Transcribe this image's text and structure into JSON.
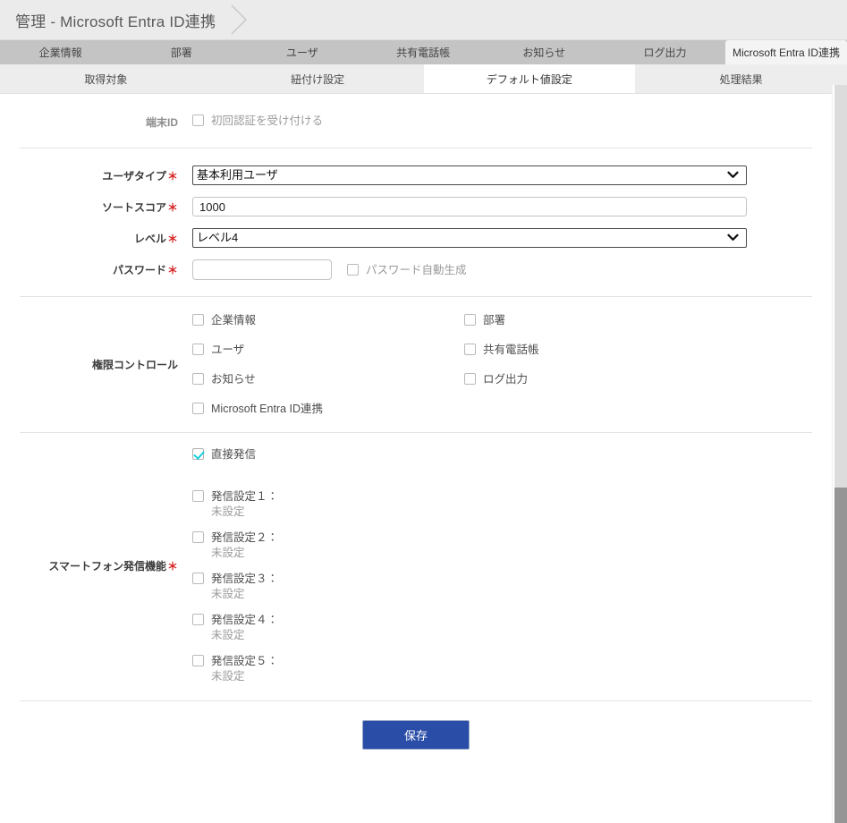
{
  "breadcrumb": {
    "title": "管理 - Microsoft Entra ID連携",
    "chevron_icon": "chevron-right-icon"
  },
  "primary_tabs": [
    {
      "label": "企業情報",
      "active": false
    },
    {
      "label": "部署",
      "active": false
    },
    {
      "label": "ユーザ",
      "active": false
    },
    {
      "label": "共有電話帳",
      "active": false
    },
    {
      "label": "お知らせ",
      "active": false
    },
    {
      "label": "ログ出力",
      "active": false
    },
    {
      "label": "Microsoft Entra ID連携",
      "active": true
    }
  ],
  "secondary_tabs": [
    {
      "label": "取得対象",
      "active": false
    },
    {
      "label": "紐付け設定",
      "active": false
    },
    {
      "label": "デフォルト値設定",
      "active": true
    },
    {
      "label": "処理結果",
      "active": false
    }
  ],
  "form": {
    "terminal": {
      "label": "端末ID",
      "checkbox_label": "初回認証を受け付ける",
      "checked": false,
      "disabled": true
    },
    "user_type": {
      "label": "ユーザタイプ",
      "required_mark": "＊",
      "value": "基本利用ユーザ",
      "options": [
        "基本利用ユーザ"
      ],
      "chevron_icon": "chevron-down-icon"
    },
    "sort_score": {
      "label": "ソートスコア",
      "required_mark": "＊",
      "value": "1000",
      "placeholder": ""
    },
    "level": {
      "label": "レベル",
      "required_mark": "＊",
      "value": "レベル4",
      "options": [
        "レベル4"
      ],
      "chevron_icon": "chevron-down-icon"
    },
    "password": {
      "label": "パスワード",
      "required_mark": "＊",
      "value": "",
      "placeholder": "",
      "auto_generate_label": "パスワード自動生成",
      "auto_generate_checked": false,
      "auto_generate_disabled": true
    },
    "permission_control": {
      "label": "権限コントロール",
      "items": [
        {
          "label": "企業情報",
          "checked": false
        },
        {
          "label": "部署",
          "checked": false
        },
        {
          "label": "ユーザ",
          "checked": false
        },
        {
          "label": "共有電話帳",
          "checked": false
        },
        {
          "label": "お知らせ",
          "checked": false
        },
        {
          "label": "ログ出力",
          "checked": false
        },
        {
          "label": "Microsoft Entra ID連携",
          "checked": false
        }
      ]
    },
    "smartphone": {
      "label": "スマートフォン発信機能",
      "required_mark": "＊",
      "direct": {
        "label": "直接発信",
        "checked": true
      },
      "settings": [
        {
          "label": "発信設定１：",
          "sub": "未設定",
          "checked": false
        },
        {
          "label": "発信設定２：",
          "sub": "未設定",
          "checked": false
        },
        {
          "label": "発信設定３：",
          "sub": "未設定",
          "checked": false
        },
        {
          "label": "発信設定４：",
          "sub": "未設定",
          "checked": false
        },
        {
          "label": "発信設定５：",
          "sub": "未設定",
          "checked": false
        }
      ]
    },
    "save_label": "保存"
  },
  "colors": {
    "accent_button": "#2a4da8",
    "required_mark": "#d32222",
    "checkbox_check": "#16cfe0",
    "primary_tab_bar": "#c4c4c4",
    "breadcrumb_bar": "#ebebeb"
  }
}
